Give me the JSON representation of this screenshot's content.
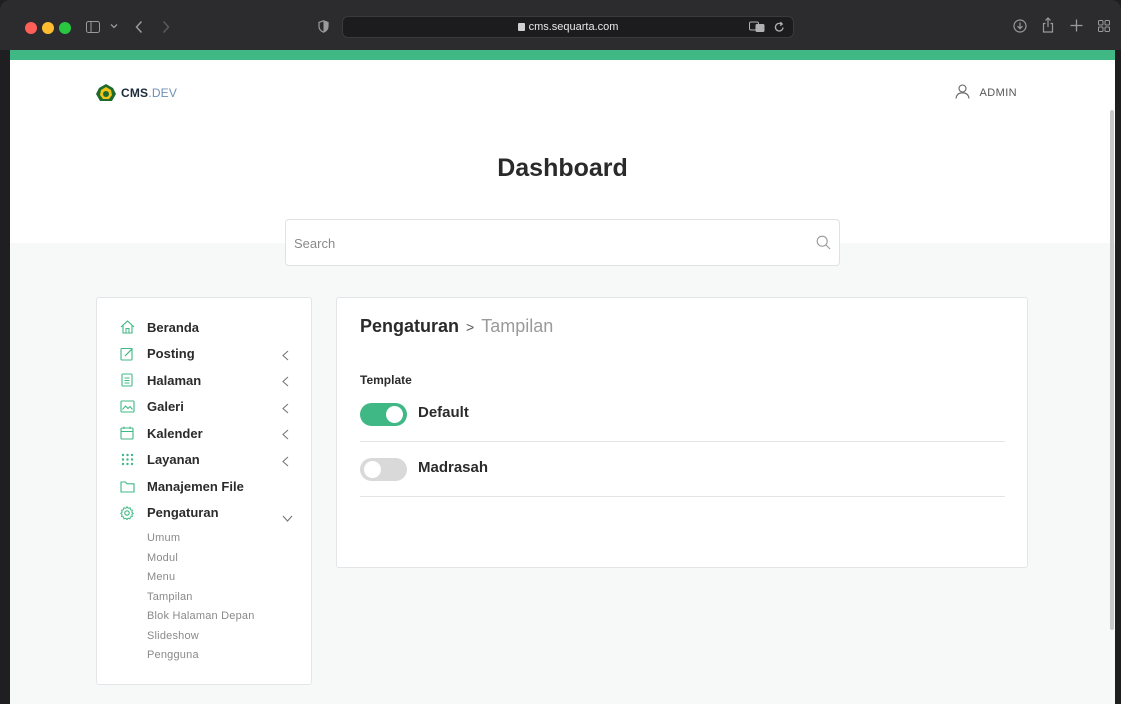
{
  "browser": {
    "url": "cms.sequarta.com"
  },
  "header": {
    "logo_text": "CMS",
    "logo_suffix": ".DEV",
    "user_label": "ADMIN"
  },
  "page_title": "Dashboard",
  "search": {
    "placeholder": "Search",
    "value": ""
  },
  "sidebar": {
    "items": [
      {
        "label": "Beranda",
        "icon": "home-icon"
      },
      {
        "label": "Posting",
        "icon": "edit-icon",
        "expandable": true
      },
      {
        "label": "Halaman",
        "icon": "document-icon",
        "expandable": true
      },
      {
        "label": "Galeri",
        "icon": "image-icon",
        "expandable": true
      },
      {
        "label": "Kalender",
        "icon": "calendar-icon",
        "expandable": true
      },
      {
        "label": "Layanan",
        "icon": "grid-icon",
        "expandable": true
      },
      {
        "label": "Manajemen File",
        "icon": "folder-icon"
      },
      {
        "label": "Pengaturan",
        "icon": "gear-icon",
        "expandable": true,
        "expanded": true
      }
    ],
    "submenu": [
      "Umum",
      "Modul",
      "Menu",
      "Tampilan",
      "Blok Halaman Depan",
      "Slideshow",
      "Pengguna"
    ]
  },
  "content": {
    "breadcrumb_main": "Pengaturan",
    "breadcrumb_sep": ">",
    "breadcrumb_sub": "Tampilan",
    "section_label": "Template",
    "options": [
      {
        "label": "Default",
        "enabled": true
      },
      {
        "label": "Madrasah",
        "enabled": false
      }
    ]
  },
  "colors": {
    "accent": "#3fb886",
    "toggle_off": "#d9d9d9"
  }
}
